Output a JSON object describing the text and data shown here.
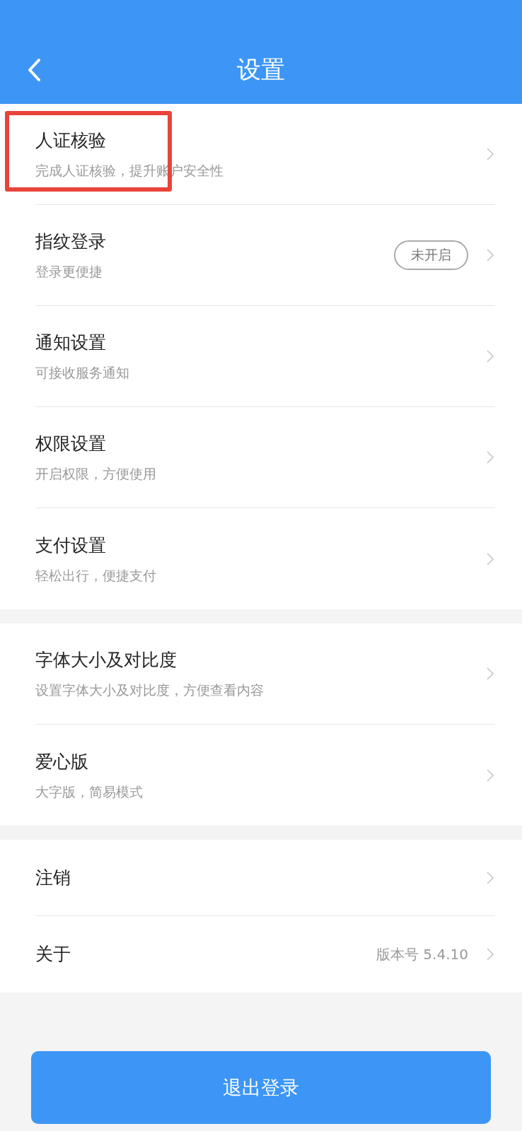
{
  "header": {
    "title": "设置"
  },
  "sections": [
    {
      "items": [
        {
          "title": "人证核验",
          "subtitle": "完成人证核验，提升账户安全性",
          "highlighted": true
        },
        {
          "title": "指纹登录",
          "subtitle": "登录更便捷",
          "badge": "未开启"
        },
        {
          "title": "通知设置",
          "subtitle": "可接收服务通知"
        },
        {
          "title": "权限设置",
          "subtitle": "开启权限，方便使用"
        },
        {
          "title": "支付设置",
          "subtitle": "轻松出行，便捷支付"
        }
      ]
    },
    {
      "items": [
        {
          "title": "字体大小及对比度",
          "subtitle": "设置字体大小及对比度，方便查看内容"
        },
        {
          "title": "爱心版",
          "subtitle": "大字版，简易模式"
        }
      ]
    },
    {
      "items": [
        {
          "title": "注销"
        },
        {
          "title": "关于",
          "value": "版本号 5.4.10"
        }
      ]
    }
  ],
  "logout_button": "退出登录"
}
